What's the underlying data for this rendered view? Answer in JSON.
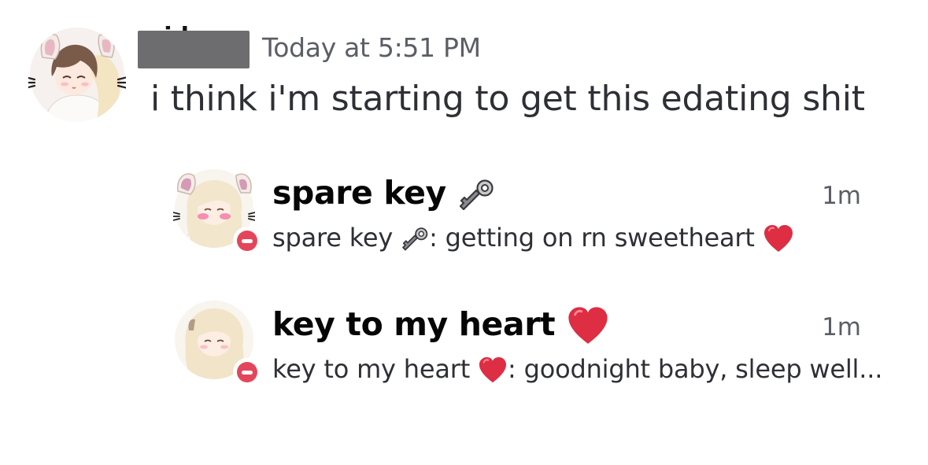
{
  "message": {
    "author": "aiden",
    "timestamp": "Today at 5:51 PM",
    "content": "i think i'm starting to get this edating shit"
  },
  "dms": [
    {
      "name": "spare key",
      "name_emoji": "old-key-icon",
      "preview_name": "spare key",
      "preview_emoji": "old-key-icon",
      "preview_text": ": getting on rn sweetheart",
      "preview_trailing_emoji": "red-heart-icon",
      "time": "1m",
      "status": "do-not-disturb"
    },
    {
      "name": "key to my heart",
      "name_emoji": "red-heart-icon",
      "preview_name": "key to my heart",
      "preview_emoji": "red-heart-icon",
      "preview_text": ": goodnight baby, sleep well...",
      "time": "1m",
      "status": "do-not-disturb"
    }
  ],
  "colors": {
    "dnd_status": "#e3465a",
    "timestamp_gray": "#5c5e66",
    "redaction_box": "#6d6d70",
    "heart_red": "#dd2e44"
  }
}
